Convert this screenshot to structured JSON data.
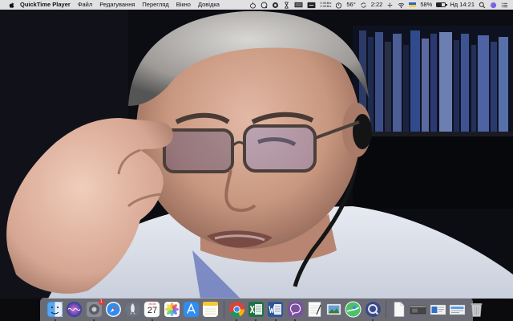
{
  "menubar": {
    "app_name": "QuickTime Player",
    "menus": [
      "Файл",
      "Редагування",
      "Перегляд",
      "Вікно",
      "Довідка"
    ],
    "net_up": "0.0KB/s",
    "net_down": "0.0KB/s",
    "temperature": "56°",
    "cpu_time": "2:22",
    "battery_percent": "58%",
    "battery_level": 0.58,
    "clock": "Нд 14:21",
    "icons": [
      "apple-icon",
      "onion-icon",
      "quicktime-icon",
      "status-icon",
      "hourglass-icon",
      "screen-icon",
      "menubar-extra-icon",
      "timer-icon",
      "sync-icon",
      "fan-icon",
      "wifi-icon",
      "ukraine-flag-icon",
      "battery-icon",
      "search-icon",
      "siri-icon",
      "notification-center-icon"
    ]
  },
  "dock": {
    "apps": [
      {
        "name": "Finder",
        "icon": "finder-icon"
      },
      {
        "name": "Siri",
        "icon": "siri-icon"
      },
      {
        "name": "System Preferences",
        "icon": "system-preferences-icon",
        "badge": "1"
      },
      {
        "name": "Safari",
        "icon": "safari-icon"
      },
      {
        "name": "Launchpad",
        "icon": "launchpad-icon"
      },
      {
        "name": "Calendar",
        "icon": "calendar-icon",
        "month": "ЖОВ",
        "day": "27"
      },
      {
        "name": "Photos",
        "icon": "photos-icon"
      },
      {
        "name": "App Store",
        "icon": "app-store-icon"
      },
      {
        "name": "Notes",
        "icon": "notes-icon"
      },
      {
        "name": "Chrome",
        "icon": "chrome-icon"
      },
      {
        "name": "Excel",
        "icon": "excel-icon"
      },
      {
        "name": "Word",
        "icon": "word-icon"
      },
      {
        "name": "Viber",
        "icon": "viber-icon"
      },
      {
        "name": "TextEdit",
        "icon": "textedit-icon"
      },
      {
        "name": "Preview",
        "icon": "preview-icon"
      },
      {
        "name": "Maps",
        "icon": "maps-icon"
      },
      {
        "name": "QuickTime",
        "icon": "quicktime-icon"
      },
      {
        "name": "Document",
        "icon": "document-icon"
      },
      {
        "name": "Minimized Window 1",
        "icon": "window-thumbnail-icon"
      },
      {
        "name": "Minimized Window 2",
        "icon": "window-thumbnail-icon"
      },
      {
        "name": "Minimized Window 3",
        "icon": "window-thumbnail-icon"
      },
      {
        "name": "Trash",
        "icon": "trash-icon"
      }
    ]
  }
}
